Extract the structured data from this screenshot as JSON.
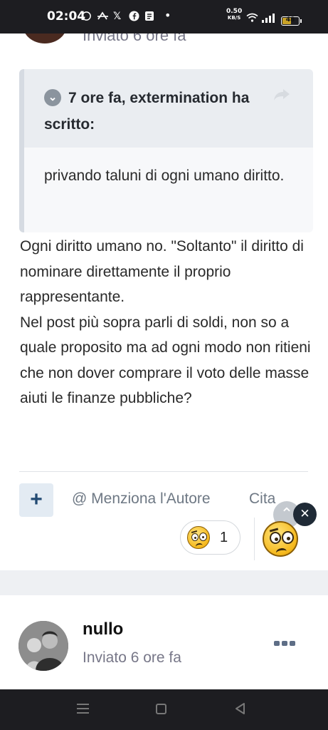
{
  "status_bar": {
    "time": "02:04",
    "net_speed_value": "0.50",
    "net_speed_unit": "KB/S",
    "battery_level": "48",
    "icons": [
      "whatsapp-icon",
      "game-icon",
      "x-icon",
      "facebook-icon",
      "news-icon",
      "dot-icon",
      "wifi-icon",
      "signal-icon",
      "battery-icon"
    ]
  },
  "previous_post": {
    "meta": "Inviato 6 ore fa"
  },
  "quote": {
    "header": "7 ore fa, extermination ha scritto:",
    "body": "privando taluni di ogni umano diritto."
  },
  "post": {
    "paragraphs": [
      "Ogni diritto umano no. \"Soltanto\" il diritto di nominare direttamente il proprio rappresentante.",
      "Nel post più sopra parli di soldi, non so a quale proposito ma ad ogni modo non ritieni che non dover comprare il voto delle masse aiuti le finanze pubbliche?"
    ]
  },
  "actions": {
    "plus_label": "+",
    "mention_label": "@ Menziona l'Autore",
    "quote_label": "Cita",
    "close_label": "✕"
  },
  "reactions": {
    "count": "1",
    "emoji": "confused-face-icon"
  },
  "next_post": {
    "author": "nullo",
    "meta": "Inviato 6 ore fa"
  },
  "colors": {
    "status_bar_bg": "#1d1d21",
    "accent_button_bg": "#e3ebf3",
    "accent_button_fg": "#224a73",
    "meta_text": "#778"
  }
}
